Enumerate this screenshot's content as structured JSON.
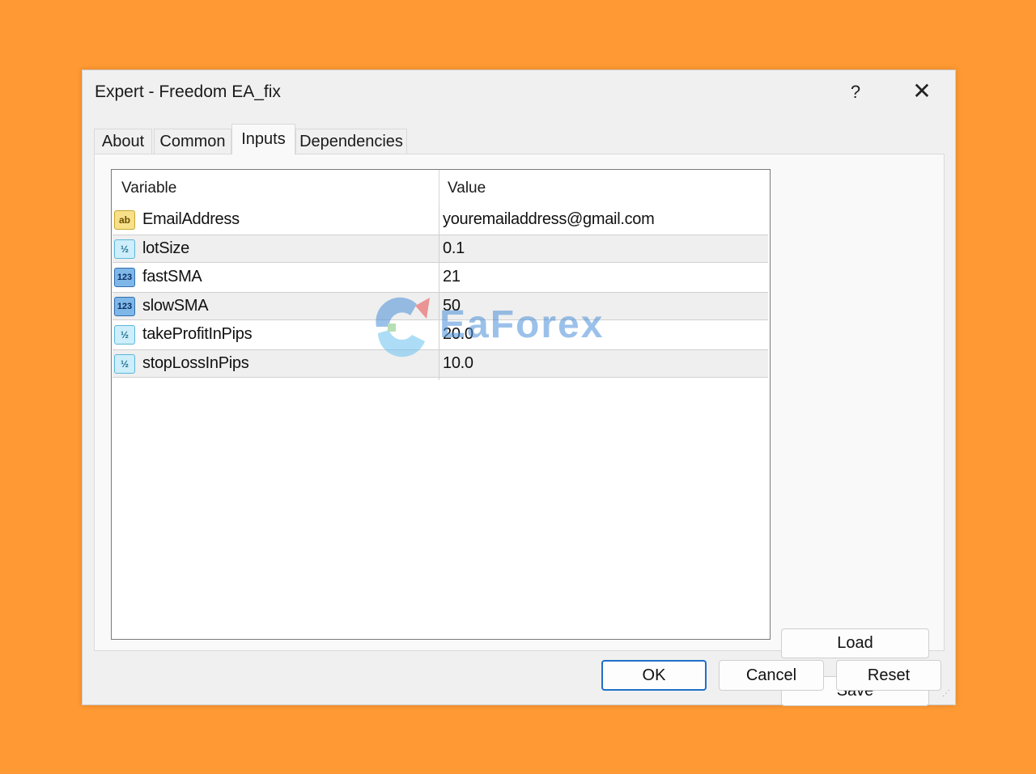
{
  "window": {
    "title": "Expert - Freedom EA_fix",
    "help_label": "?",
    "close_label": "✕"
  },
  "tabs": [
    {
      "label": "About"
    },
    {
      "label": "Common"
    },
    {
      "label": "Inputs",
      "active": true
    },
    {
      "label": "Dependencies"
    }
  ],
  "grid": {
    "headers": {
      "variable": "Variable",
      "value": "Value"
    },
    "rows": [
      {
        "icon": "string-type-icon",
        "icon_text": "ab",
        "variable": "EmailAddress",
        "value": "youremailaddress@gmail.com"
      },
      {
        "icon": "double-type-icon",
        "icon_text": "½",
        "variable": "lotSize",
        "value": "0.1"
      },
      {
        "icon": "integer-type-icon",
        "icon_text": "123",
        "variable": "fastSMA",
        "value": "21"
      },
      {
        "icon": "integer-type-icon",
        "icon_text": "123",
        "variable": "slowSMA",
        "value": "50"
      },
      {
        "icon": "double-type-icon",
        "icon_text": "½",
        "variable": "takeProfitInPips",
        "value": "20.0"
      },
      {
        "icon": "double-type-icon",
        "icon_text": "½",
        "variable": "stopLossInPips",
        "value": "10.0"
      }
    ]
  },
  "side_buttons": {
    "load": "Load",
    "save": "Save"
  },
  "footer_buttons": {
    "ok": "OK",
    "cancel": "Cancel",
    "reset": "Reset"
  },
  "watermark": {
    "text": "EaForex"
  },
  "colors": {
    "background": "#FF9933",
    "default_button_border": "#1F6FC9",
    "watermark": "#4A90D9"
  }
}
